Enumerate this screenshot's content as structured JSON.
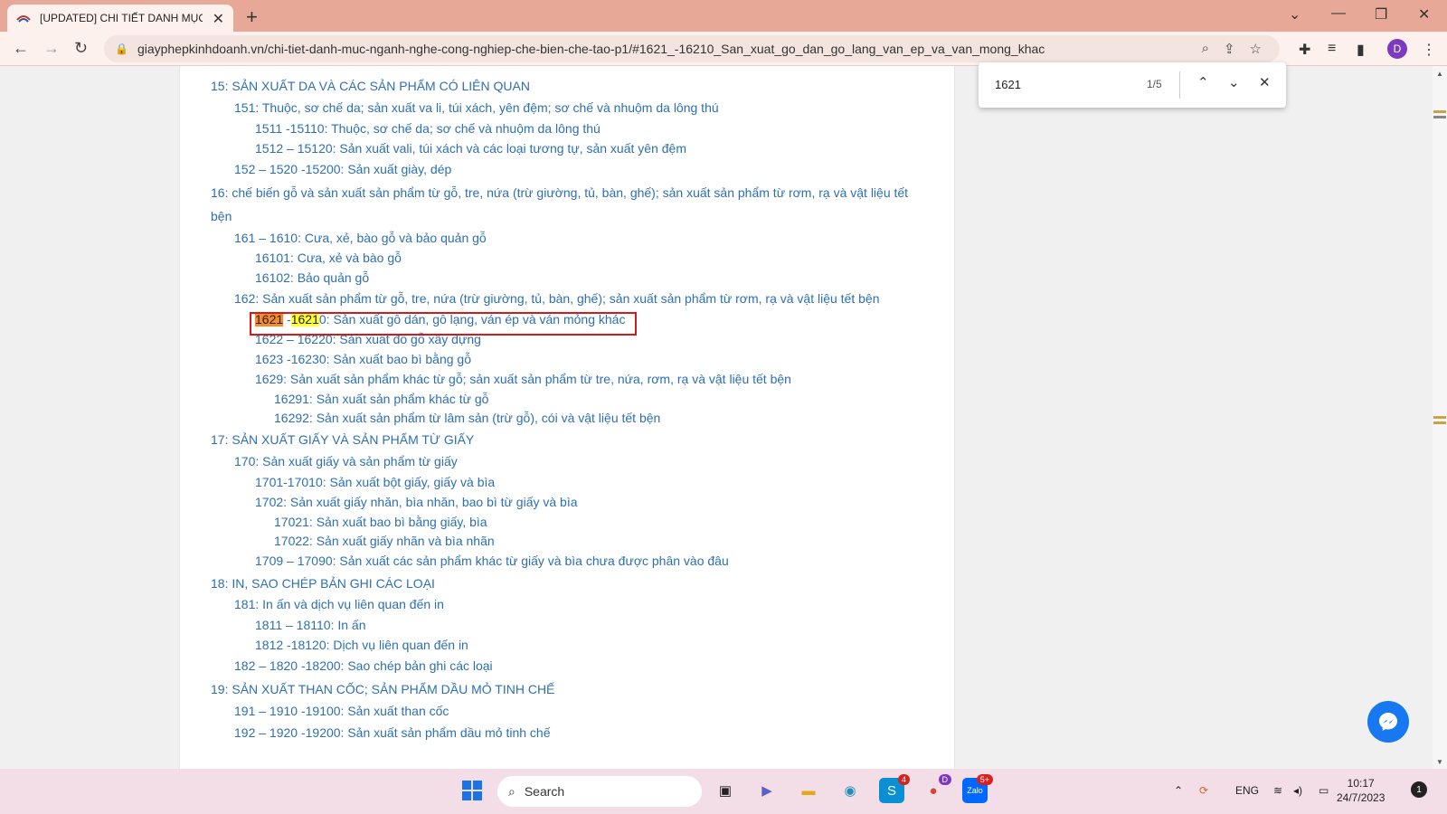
{
  "browser": {
    "tab_title": "[UPDATED] CHI TIẾT DANH MỤC",
    "url": "giayphepkinhdoanh.vn/chi-tiet-danh-muc-nganh-nghe-cong-nghiep-che-bien-che-tao-p1/#1621_-16210_San_xuat_go_dan_go_lang_van_ep_va_van_mong_khac",
    "profile_initial": "D"
  },
  "find": {
    "query": "1621",
    "count": "1/5"
  },
  "content": {
    "l0": "15: SẢN XUẤT DA VÀ CÁC SẢN PHẨM CÓ LIÊN QUAN",
    "l1": "151: Thuộc, sơ chế da; sản xuất va li, túi xách, yên đệm; sơ chế và nhuộm da lông thú",
    "l2": "1511 -15110: Thuộc, sơ chế da; sơ chế và nhuộm da lông thú",
    "l3": "1512 – 15120: Sản xuất vali, túi xách và các loại tương tự, sản xuất yên đệm",
    "l4": "152 – 1520 -15200: Sản xuất giày, dép",
    "l5a": "16: chế biến gỗ và sản xuất sản phẩm từ gỗ, tre, nứa (trừ giường, tủ, bàn, ghế); sản xuất sản phẩm từ rơm, rạ và vật liệu tết",
    "l5b": "bện",
    "l6": "161 – 1610: Cưa, xẻ, bào gỗ và bảo quản gỗ",
    "l7": "16101: Cưa, xẻ và bào gỗ",
    "l8": "16102: Bảo quản gỗ",
    "l9": "162: Sản xuất sản phẩm từ gỗ, tre, nứa (trừ giường, tủ, bàn, ghế); sản xuất sản phẩm từ rơm, rạ và vật liệu tết bện",
    "l10_hl1": "1621",
    "l10_mid": " -",
    "l10_hl2": "1621",
    "l10_rest": "0: Sản xuất gỗ dán, gỗ lạng, ván ép và ván mỏng khác",
    "l11": "1622 – 16220: Sản xuất đồ gỗ xây dựng",
    "l12": "1623 -16230: Sản xuất bao bì bằng gỗ",
    "l13": "1629: Sản xuất sản phẩm khác từ gỗ; sản xuất sản phẩm từ tre, nứa, rơm, rạ và vật liệu tết bện",
    "l14": "16291: Sản xuất sản phẩm khác từ gỗ",
    "l15": "16292: Sản xuất sản phẩm từ lâm sản (trừ gỗ), cói và vật liệu tết bện",
    "l16": "17: SẢN XUẤT GIẤY VÀ SẢN PHẨM TỪ GIẤY",
    "l17": "170: Sản xuất giấy và sản phẩm từ giấy",
    "l18": "1701-17010: Sản xuất bột giấy, giấy và bìa",
    "l19": "1702: Sản xuất giấy nhăn, bìa nhăn, bao bì từ giấy và bìa",
    "l20": "17021: Sản xuất bao bì bằng giấy, bìa",
    "l21": "17022: Sản xuất giấy nhãn và bìa nhãn",
    "l22": "1709 – 17090: Sản xuất các sản phẩm khác từ giấy và bìa chưa được phân vào đâu",
    "l23": "18: IN, SAO CHÉP BẢN GHI CÁC LOẠI",
    "l24": "181: In ấn và dịch vụ liên quan đến in",
    "l25": "1811 – 18110: In ấn",
    "l26": "1812 -18120: Dịch vụ liên quan đến in",
    "l27": "182 – 1820 -18200: Sao chép bản ghi các loại",
    "l28": "19: SẢN XUẤT THAN CỐC; SẢN PHẨM DẦU MỎ TINH CHẾ",
    "l29": "191 – 1910 -19100: Sản xuất than cốc",
    "l30": "192 – 1920 -19200: Sản xuất sản phẩm dầu mỏ tinh chế"
  },
  "taskbar": {
    "search_label": "Search",
    "skype_badge": "4",
    "zalo_badge": "5+",
    "chrome_profile": "D",
    "lang": "ENG",
    "time": "10:17",
    "date": "24/7/2023",
    "notif_count": "1"
  }
}
